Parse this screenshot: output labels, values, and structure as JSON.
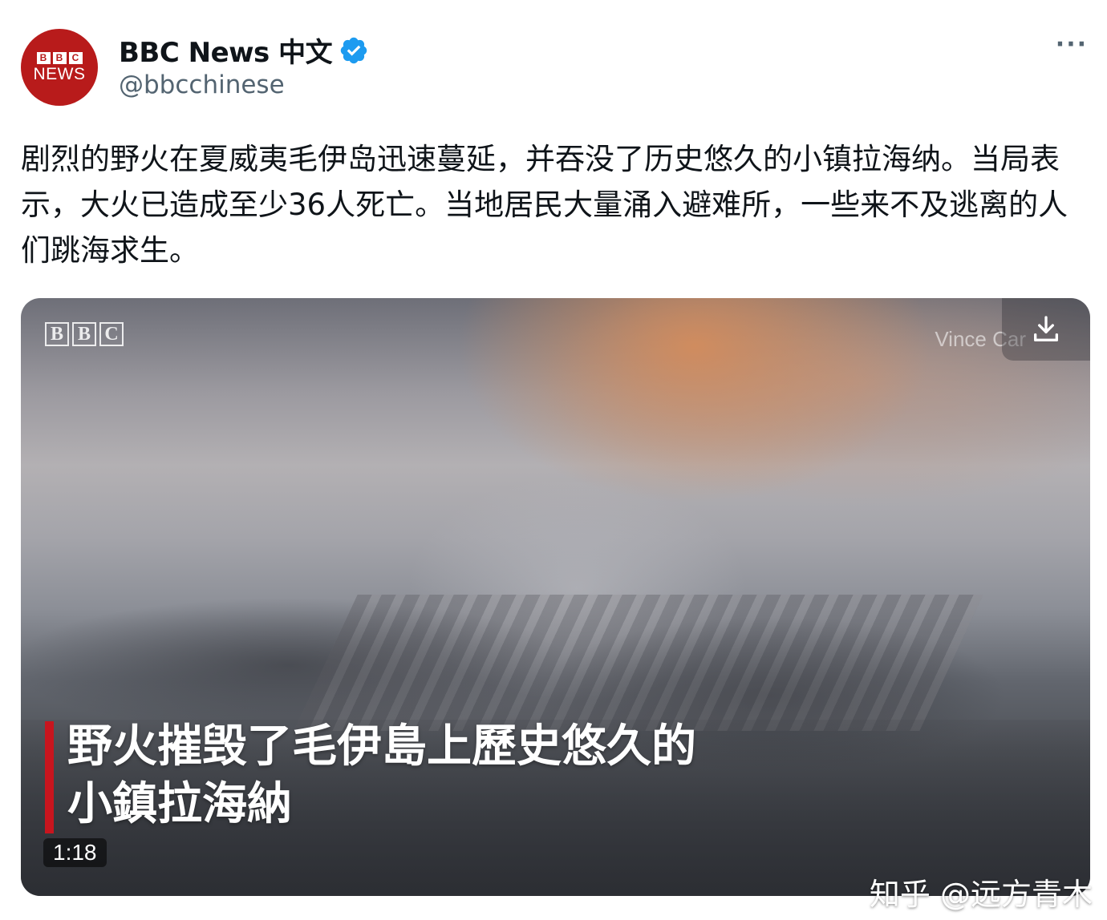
{
  "author": {
    "avatar_blocks": [
      "B",
      "B",
      "C"
    ],
    "avatar_text": "NEWS",
    "display_name": "BBC News 中文",
    "handle": "@bbcchinese",
    "verified": true,
    "verified_color": "#1d9bf0",
    "avatar_color": "#b81b1b"
  },
  "more_label": "···",
  "tweet": {
    "text": "剧烈的野火在夏威夷毛伊岛迅速蔓延，并吞没了历史悠久的小镇拉海纳。当局表示，大火已造成至少36人死亡。当地居民大量涌入避难所，一些来不及逃离的人们跳海求生。"
  },
  "media": {
    "logo_letters": [
      "B",
      "B",
      "C"
    ],
    "credit": "Vince Car",
    "caption_line1": "野火摧毁了毛伊島上歷史悠久的",
    "caption_line2": "小鎮拉海納",
    "caption_bar_color": "#c8151e",
    "duration": "1:18",
    "download_icon": "download-icon"
  },
  "watermark": "知乎 @远方青木"
}
